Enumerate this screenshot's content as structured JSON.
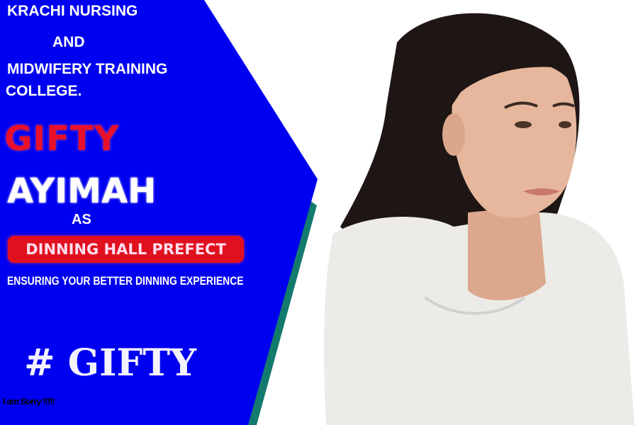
{
  "poster": {
    "college_line1": "KRACHI NURSING",
    "college_line2": "AND",
    "college_line3": "MIDWIFERY TRAINING",
    "college_line4": "COLLEGE.",
    "first_name": "GIFTY",
    "last_name": "AYIMAH",
    "as_word": "AS",
    "position": "DINNING HALL PREFECT",
    "tagline": "ENSURING YOUR BETTER  DINNING EXPERIENCE",
    "hashtag": "# GIFTY",
    "footnote": "I am Sorry !!!!!"
  },
  "colors": {
    "panel": "#0000f0",
    "accent_strip": "#137a6e",
    "name_red": "#e8102a",
    "badge_red": "#e0101e"
  },
  "photo": {
    "subject": "woman-portrait-image"
  }
}
